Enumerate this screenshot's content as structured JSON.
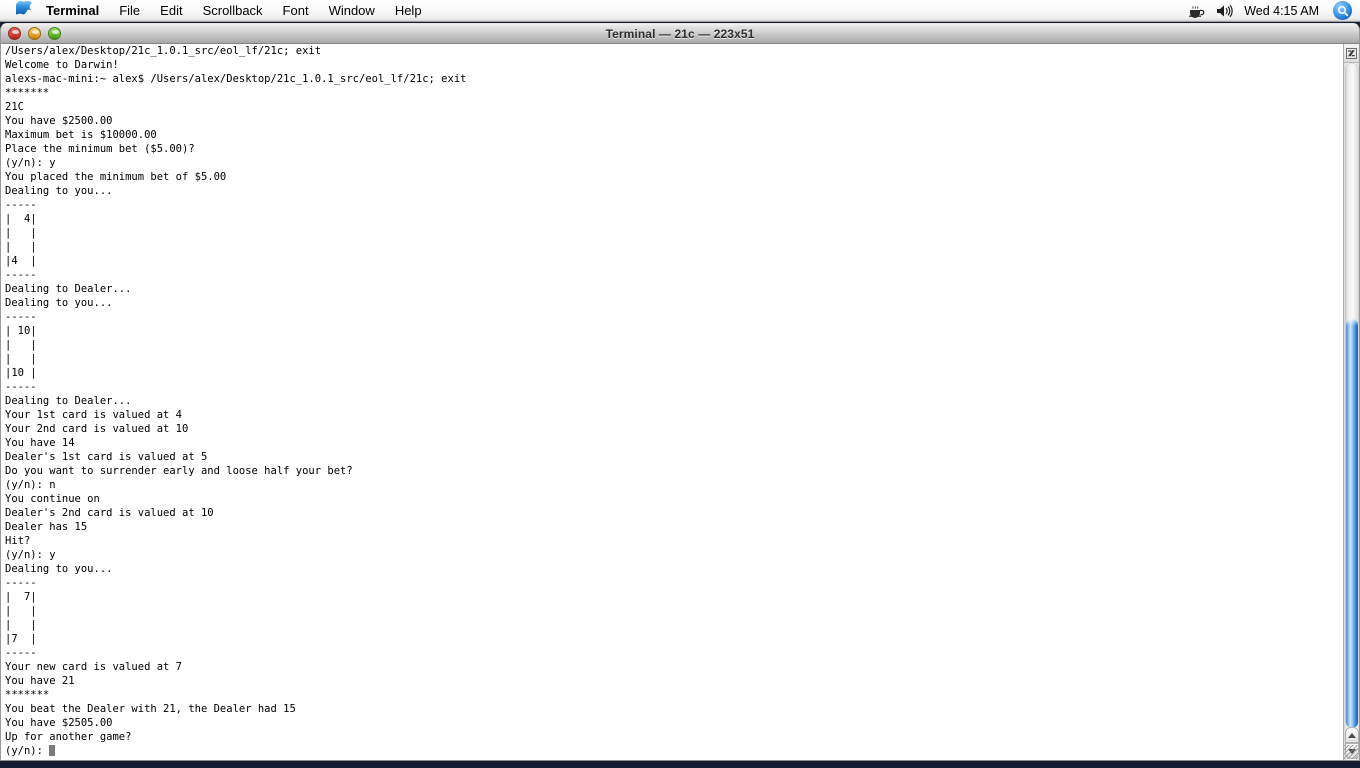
{
  "menubar": {
    "apple_icon": "apple-logo-icon",
    "app_name": "Terminal",
    "items": [
      "File",
      "Edit",
      "Scrollback",
      "Font",
      "Window",
      "Help"
    ],
    "status": {
      "coffee_icon": "coffee-cup-icon",
      "volume_icon": "speaker-volume-icon",
      "clock": "Wed 4:15 AM",
      "spotlight_icon": "spotlight-search-icon",
      "spotlight_glyph": "⚲"
    }
  },
  "window": {
    "title": "Terminal — 21c — 223x51",
    "controls": {
      "close": "close-button",
      "minimize": "minimize-button",
      "zoom": "zoom-button"
    },
    "scrollbar": {
      "lock_icon": "scroll-lock-icon",
      "up_arrow": "scroll-up-arrow",
      "down_arrow": "scroll-down-arrow",
      "thumb": "scroll-thumb"
    },
    "resize_grip": "resize-grip"
  },
  "terminal": {
    "cursor": "block-cursor",
    "lines": [
      "/Users/alex/Desktop/21c_1.0.1_src/eol_lf/21c; exit",
      "Welcome to Darwin!",
      "alexs-mac-mini:~ alex$ /Users/alex/Desktop/21c_1.0.1_src/eol_lf/21c; exit",
      "*******",
      "21C",
      "You have $2500.00",
      "Maximum bet is $10000.00",
      "Place the minimum bet ($5.00)?",
      "(y/n): y",
      "You placed the minimum bet of $5.00",
      "Dealing to you...",
      "-----",
      "|  4|",
      "|   |",
      "|   |",
      "|4  |",
      "-----",
      "Dealing to Dealer...",
      "Dealing to you...",
      "-----",
      "| 10|",
      "|   |",
      "|   |",
      "|10 |",
      "-----",
      "Dealing to Dealer...",
      "Your 1st card is valued at 4",
      "Your 2nd card is valued at 10",
      "You have 14",
      "Dealer's 1st card is valued at 5",
      "Do you want to surrender early and loose half your bet?",
      "(y/n): n",
      "You continue on",
      "Dealer's 2nd card is valued at 10",
      "Dealer has 15",
      "Hit?",
      "(y/n): y",
      "Dealing to you...",
      "-----",
      "|  7|",
      "|   |",
      "|   |",
      "|7  |",
      "-----",
      "Your new card is valued at 7",
      "You have 21",
      "*******",
      "You beat the Dealer with 21, the Dealer had 15",
      "You have $2505.00",
      "Up for another game?"
    ],
    "prompt_line": "(y/n): "
  },
  "colors": {
    "desktop": "#141b33",
    "terminal_bg": "#ffffff",
    "terminal_fg": "#000000",
    "scroll_thumb": "#3f8ce0",
    "cursor": "#7a7a7a"
  }
}
